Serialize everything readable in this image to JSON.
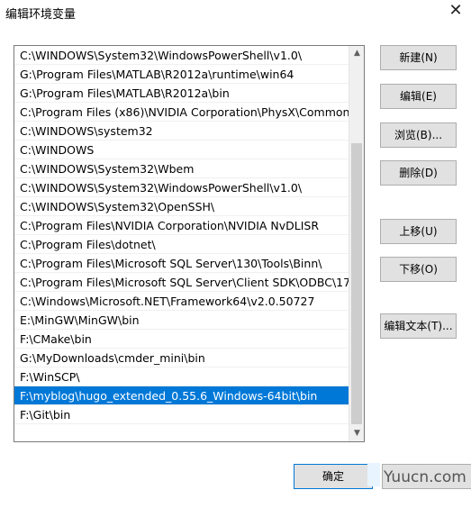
{
  "window": {
    "title": "编辑环境变量",
    "close_symbol": "✕"
  },
  "path_list": {
    "entries": [
      "C:\\WINDOWS\\System32\\WindowsPowerShell\\v1.0\\",
      "G:\\Program Files\\MATLAB\\R2012a\\runtime\\win64",
      "G:\\Program Files\\MATLAB\\R2012a\\bin",
      "C:\\Program Files (x86)\\NVIDIA Corporation\\PhysX\\Common",
      "C:\\WINDOWS\\system32",
      "C:\\WINDOWS",
      "C:\\WINDOWS\\System32\\Wbem",
      "C:\\WINDOWS\\System32\\WindowsPowerShell\\v1.0\\",
      "C:\\WINDOWS\\System32\\OpenSSH\\",
      "C:\\Program Files\\NVIDIA Corporation\\NVIDIA NvDLISR",
      "C:\\Program Files\\dotnet\\",
      "C:\\Program Files\\Microsoft SQL Server\\130\\Tools\\Binn\\",
      "C:\\Program Files\\Microsoft SQL Server\\Client SDK\\ODBC\\17...",
      "C:\\Windows\\Microsoft.NET\\Framework64\\v2.0.50727",
      "E:\\MinGW\\MinGW\\bin",
      "F:\\CMake\\bin",
      "G:\\MyDownloads\\cmder_mini\\bin",
      "F:\\WinSCP\\",
      "F:\\myblog\\hugo_extended_0.55.6_Windows-64bit\\bin",
      "F:\\Git\\bin"
    ],
    "selected_index": 18
  },
  "buttons": {
    "new": "新建(N)",
    "edit": "编辑(E)",
    "browse": "浏览(B)...",
    "delete": "删除(D)",
    "move_up": "上移(U)",
    "move_down": "下移(O)",
    "edit_text": "编辑文本(T)...",
    "ok": "确定"
  },
  "scrollbar": {
    "up_arrow": "▲",
    "down_arrow": "▼"
  },
  "watermark": {
    "text": "Yuucn.com"
  }
}
